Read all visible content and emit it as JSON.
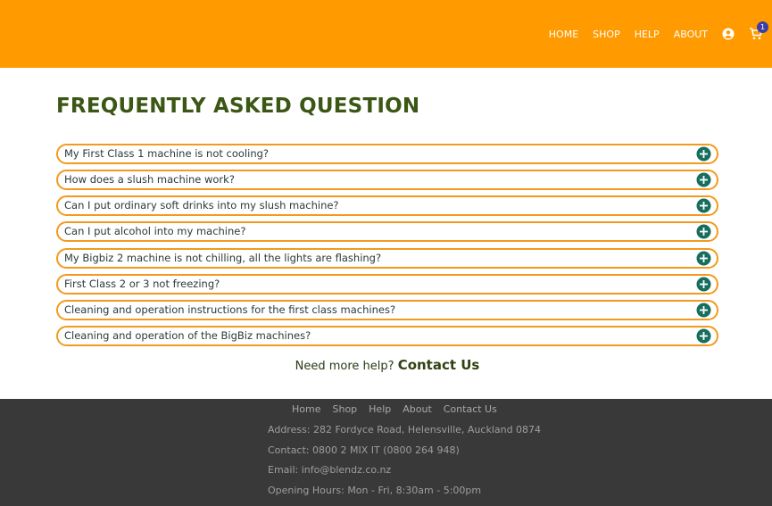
{
  "header": {
    "nav": [
      "HOME",
      "SHOP",
      "HELP",
      "ABOUT"
    ],
    "cart_count": "1",
    "icons": [
      "user-icon",
      "cart-icon"
    ]
  },
  "main": {
    "title": "FREQUENTLY ASKED QUESTION",
    "faqs": [
      "My First Class 1 machine is not cooling?",
      "How does a slush machine work?",
      "Can I put ordinary soft drinks into my slush machine?",
      "Can I put alcohol into my machine?",
      "My Bigbiz 2 machine is not chilling, all the lights are flashing?",
      "First Class 2 or 3 not freezing?",
      "Cleaning and operation instructions for the first class machines?",
      "Cleaning and operation of the BigBiz machines?"
    ],
    "help_text": "Need more help?",
    "help_link": "Contact Us"
  },
  "footer": {
    "nav": [
      "Home",
      "Shop",
      "Help",
      "About",
      "Contact Us"
    ],
    "address": "Address: 282 Fordyce Road, Helensville, Auckland 0874",
    "contact": "Contact: 0800 2 MIX IT (0800 264 948)",
    "email": "Email:  info@blendz.co.nz",
    "hours": "Opening Hours: Mon - Fri, 8:30am - 5:00pm"
  },
  "colors": {
    "header_bg": "#ff9a00",
    "title": "#3b5615",
    "accordion_border": "#f39a1e",
    "plus_icon": "#166f5e",
    "footer_bg": "#393939"
  }
}
